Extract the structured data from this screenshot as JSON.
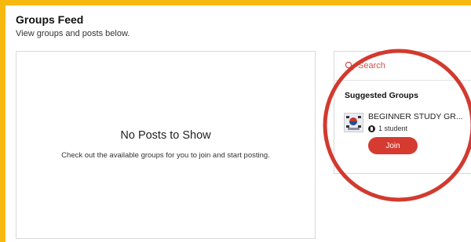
{
  "header": {
    "title": "Groups Feed",
    "subtitle": "View groups and posts below."
  },
  "feed": {
    "empty_title": "No Posts to Show",
    "empty_text": "Check out the available groups for you to join and start posting."
  },
  "sidebar": {
    "search_placeholder": "Search",
    "suggested_title": "Suggested Groups",
    "groups": [
      {
        "name": "BEGINNER STUDY GR...",
        "members": "1 student",
        "join_label": "Join"
      }
    ]
  },
  "colors": {
    "frame": "#F7B90F",
    "join_button": "#d63b31",
    "annotation_circle": "#d23a2f"
  },
  "icons": {
    "search": "search-icon",
    "member": "member-icon"
  }
}
